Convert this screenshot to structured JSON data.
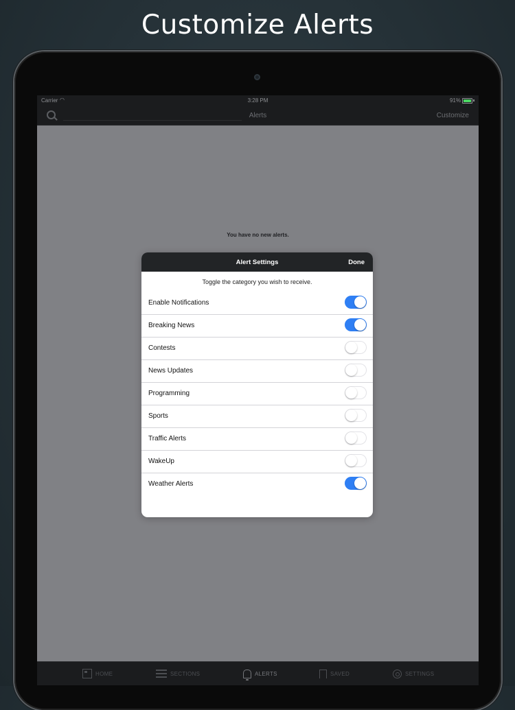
{
  "headline": "Customize Alerts",
  "status_bar": {
    "carrier": "Carrier",
    "time": "3:28 PM",
    "battery": "91%",
    "battery_level": 0.91
  },
  "nav": {
    "title": "Alerts",
    "customize_label": "Customize"
  },
  "empty_message": "You have no new alerts.",
  "modal": {
    "title": "Alert Settings",
    "done_label": "Done",
    "instruction": "Toggle the category you wish to receive.",
    "items": [
      {
        "label": "Enable Notifications",
        "on": true
      },
      {
        "label": "Breaking News",
        "on": true
      },
      {
        "label": "Contests",
        "on": false
      },
      {
        "label": "News Updates",
        "on": false
      },
      {
        "label": "Programming",
        "on": false
      },
      {
        "label": "Sports",
        "on": false
      },
      {
        "label": "Traffic Alerts",
        "on": false
      },
      {
        "label": "WakeUp",
        "on": false
      },
      {
        "label": "Weather Alerts",
        "on": true
      }
    ]
  },
  "tabs": [
    {
      "label": "HOME",
      "icon": "home-icon",
      "active": false
    },
    {
      "label": "SECTIONS",
      "icon": "menu-icon",
      "active": false
    },
    {
      "label": "ALERTS",
      "icon": "bell-icon",
      "active": true
    },
    {
      "label": "SAVED",
      "icon": "bookmark-icon",
      "active": false
    },
    {
      "label": "SETTINGS",
      "icon": "gear-icon",
      "active": false
    }
  ],
  "colors": {
    "toggle_on": "#2f7ff4",
    "modal_header": "#222426",
    "screen_bg": "#808185"
  }
}
